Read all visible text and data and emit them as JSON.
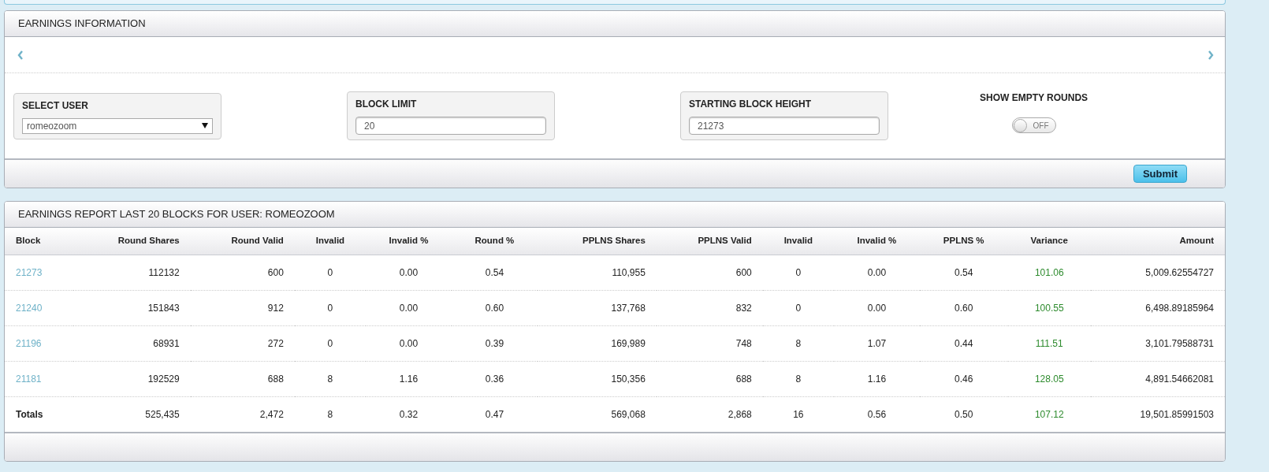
{
  "info_panel": {
    "title": "EARNINGS INFORMATION",
    "select_user": {
      "label": "SELECT USER",
      "value": "romeozoom"
    },
    "block_limit": {
      "label": "BLOCK LIMIT",
      "value": "20"
    },
    "starting_block": {
      "label": "STARTING BLOCK HEIGHT",
      "value": "21273"
    },
    "show_empty_rounds": {
      "label": "SHOW EMPTY ROUNDS",
      "on": false,
      "state_text": "OFF"
    },
    "submit": "Submit"
  },
  "report_panel": {
    "title": "EARNINGS REPORT LAST 20 BLOCKS FOR USER: ROMEOZOOM",
    "table": {
      "columns": [
        {
          "label": "Block",
          "kind": "link"
        },
        {
          "label": "Round Shares",
          "kind": "number"
        },
        {
          "label": "Round Valid",
          "kind": "number"
        },
        {
          "label": "Invalid",
          "kind": "center"
        },
        {
          "label": "Invalid %",
          "kind": "center"
        },
        {
          "label": "Round %",
          "kind": "center"
        },
        {
          "label": "PPLNS Shares",
          "kind": "number"
        },
        {
          "label": "PPLNS Valid",
          "kind": "number"
        },
        {
          "label": "Invalid",
          "kind": "center"
        },
        {
          "label": "Invalid %",
          "kind": "center"
        },
        {
          "label": "PPLNS %",
          "kind": "center"
        },
        {
          "label": "Variance",
          "kind": "good"
        },
        {
          "label": "Amount",
          "kind": "number"
        }
      ],
      "rows": [
        [
          "21273",
          "112132",
          "600",
          "0",
          "0.00",
          "0.54",
          "110,955",
          "600",
          "0",
          "0.00",
          "0.54",
          "101.06",
          "5,009.62554727"
        ],
        [
          "21240",
          "151843",
          "912",
          "0",
          "0.00",
          "0.60",
          "137,768",
          "832",
          "0",
          "0.00",
          "0.60",
          "100.55",
          "6,498.89185964"
        ],
        [
          "21196",
          "68931",
          "272",
          "0",
          "0.00",
          "0.39",
          "169,989",
          "748",
          "8",
          "1.07",
          "0.44",
          "111.51",
          "3,101.79588731"
        ],
        [
          "21181",
          "192529",
          "688",
          "8",
          "1.16",
          "0.36",
          "150,356",
          "688",
          "8",
          "1.16",
          "0.46",
          "128.05",
          "4,891.54662081"
        ]
      ],
      "totals": [
        "Totals",
        "525,435",
        "2,472",
        "8",
        "0.32",
        "0.47",
        "569,068",
        "2,868",
        "16",
        "0.56",
        "0.50",
        "107.12",
        "19,501.85991503"
      ]
    }
  }
}
